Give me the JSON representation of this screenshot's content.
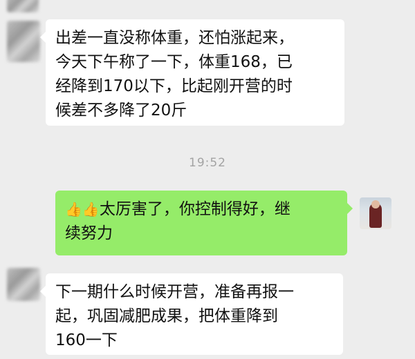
{
  "messages": [
    {
      "sender": "other",
      "lines": [
        "出差一直没称体重，还怕涨起来，",
        "今天下午称了一下，体重168，已",
        "经降到170以下，比起刚开营的时",
        "候差不多降了20斤"
      ]
    },
    {
      "sender": "timestamp",
      "text": "19:52"
    },
    {
      "sender": "self",
      "emoji": [
        "thumbs-up",
        "thumbs-up"
      ],
      "lines": [
        "太厉害了，你控制得好，继",
        "续努力"
      ]
    },
    {
      "sender": "other",
      "lines": [
        "下一期什么时候开营，准备再报一",
        "起，巩固减肥成果，把体重降到",
        "160一下"
      ]
    }
  ],
  "colors": {
    "background": "#ededed",
    "incoming_bubble": "#ffffff",
    "outgoing_bubble": "#95ec69",
    "timestamp_text": "#a3a3a3"
  },
  "icons": {
    "thumb_glyph": "👍"
  }
}
